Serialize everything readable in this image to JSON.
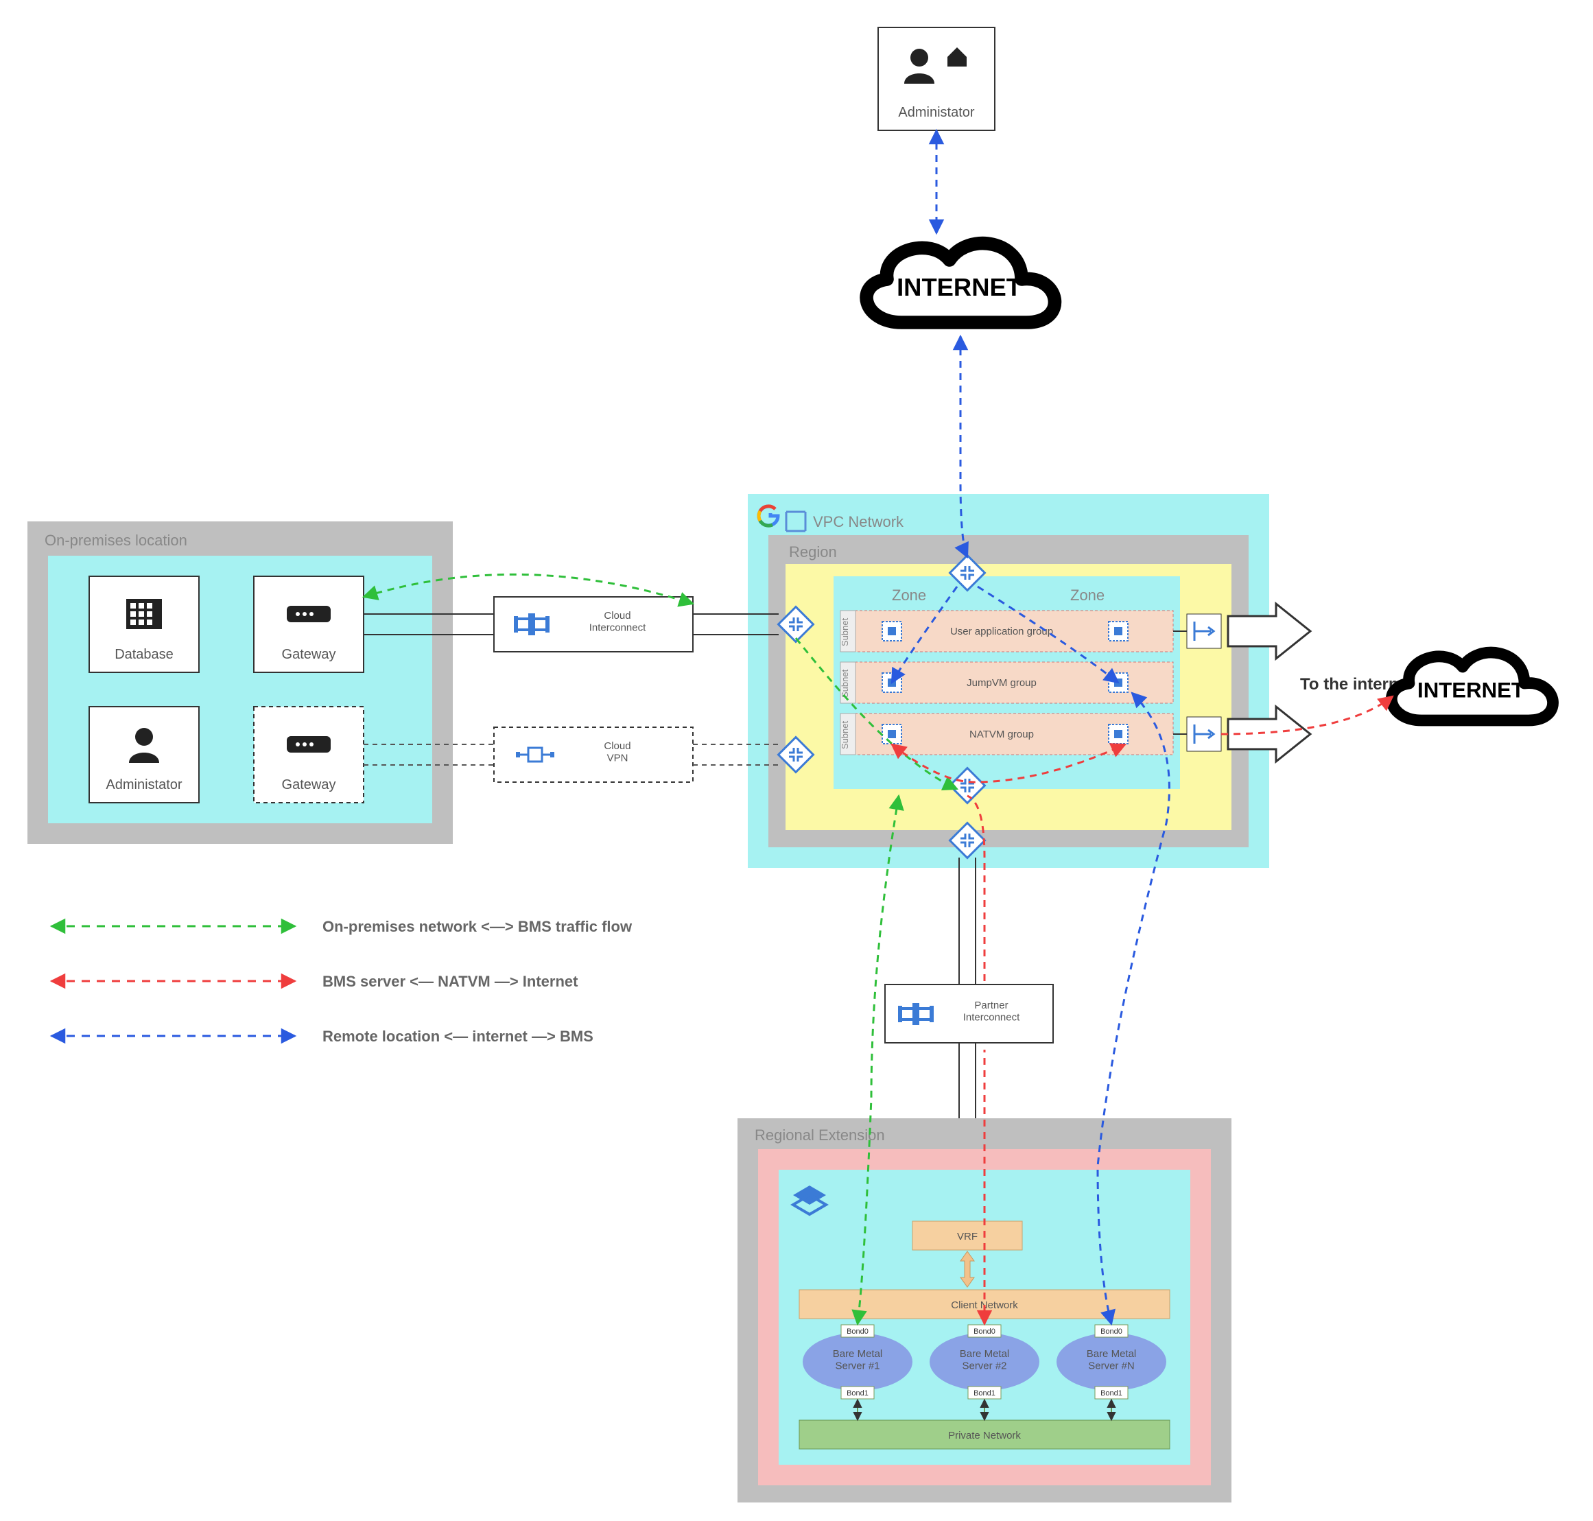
{
  "onprem": {
    "title": "On-premises location",
    "items": {
      "db": "Database",
      "gw1": "Gateway",
      "admin": "Administator",
      "gw2": "Gateway"
    }
  },
  "interconnect": {
    "cloud": "Cloud\nInterconnect",
    "vpn": "Cloud\nVPN",
    "partner": "Partner\nInterconnect"
  },
  "admin_top": "Administator",
  "internet": "INTERNET",
  "to_internet": "To the internet",
  "vpc": {
    "title": "VPC Network",
    "region": "Region",
    "zone": "Zone",
    "subnet": "Subnet",
    "groups": {
      "app": "User application group",
      "jump": "JumpVM group",
      "nat": "NATVM group"
    }
  },
  "regional": {
    "title": "Regional Extension",
    "vrf": "VRF",
    "client_net": "Client Network",
    "priv_net": "Private Network",
    "bond0": "Bond0",
    "bond1": "Bond1",
    "servers": {
      "s1": "Bare Metal\nServer #1",
      "s2": "Bare Metal\nServer #2",
      "sN": "Bare Metal\nServer #N"
    }
  },
  "legend": {
    "green": "On-premises network <—> BMS traffic flow",
    "red": "BMS server   <— NATVM —>   Internet",
    "blue": "Remote location   <— internet —>   BMS"
  }
}
